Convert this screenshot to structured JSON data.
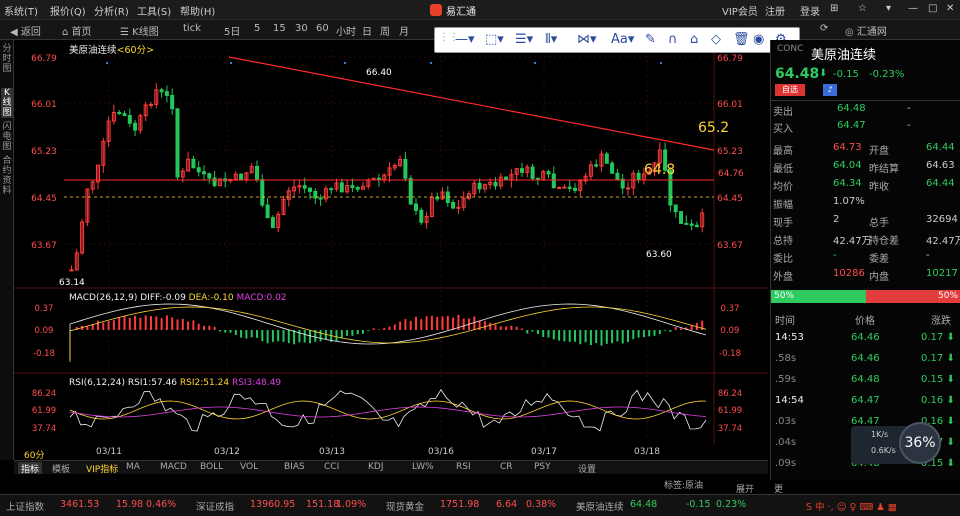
{
  "menu": {
    "items": [
      "系统(T)",
      "报价(Q)",
      "分析(R)",
      "工具(S)",
      "帮助(H)"
    ],
    "brand": "易汇通",
    "vip": "VIP会员",
    "register": "注册",
    "login": "登录"
  },
  "toolbar": {
    "back": "返回",
    "home": "首页",
    "kline": "K线图",
    "tick": "tick",
    "periods": [
      "5日",
      "5",
      "15",
      "30",
      "60",
      "小时",
      "日",
      "周",
      "月"
    ],
    "huitong": "汇通网"
  },
  "left_tabs": [
    "分时图",
    "K线图",
    "闪电图",
    "合约资料"
  ],
  "chart": {
    "title": "美原油连续",
    "period": "<60分>",
    "price_labels": [
      "66.79",
      "66.01",
      "65.23",
      "64.45",
      "63.67"
    ],
    "high_mark": "66.40",
    "low_mark": "63.14",
    "low_mark2": "63.60",
    "annot_652": "65.2",
    "annot_648": "64.8",
    "hline_value": "64.76",
    "last_value": "64.45",
    "dates": [
      "03/11",
      "03/12",
      "03/13",
      "03/16",
      "03/17",
      "03/18"
    ],
    "macd": {
      "header": "MACD(26,12,9)",
      "diff": "DIFF:-0.09",
      "dea": "DEA:-0.10",
      "macd": "MACD:0.02",
      "labels": [
        "0.37",
        "0.09",
        "-0.18"
      ]
    },
    "rsi": {
      "header": "RSI(6,12,24)",
      "rsi1": "RSI1:57.46",
      "rsi2": "RSI2:51.24",
      "rsi3": "RSI3:48.49",
      "labels": [
        "86.24",
        "61.99",
        "37.74"
      ]
    },
    "period_label": "60分"
  },
  "bottom_tabs": [
    "指标",
    "模板",
    "VIP指标",
    "MA",
    "MACD",
    "BOLL",
    "VOL",
    "BIAS",
    "CCI",
    "KDJ",
    "LW%",
    "RSI",
    "CR",
    "PSY",
    "设置"
  ],
  "bottom_tags": {
    "tag": "标签:原油",
    "expand": "展开",
    "more": "更"
  },
  "quote": {
    "code": "CONC",
    "name": "美原油连续",
    "price": "64.48",
    "change": "-0.15",
    "pct": "-0.23%",
    "self_select": "自选",
    "sell": [
      "卖出",
      "64.48",
      "-"
    ],
    "buy": [
      "买入",
      "64.47",
      "-"
    ],
    "rows": [
      [
        "最高",
        "64.73",
        "开盘",
        "64.44"
      ],
      [
        "最低",
        "64.04",
        "昨结算",
        "64.63"
      ],
      [
        "均价",
        "64.34",
        "昨收",
        "64.44"
      ],
      [
        "振幅",
        "1.07%",
        "",
        ""
      ],
      [
        "现手",
        "2",
        "总手",
        "32694"
      ],
      [
        "总持",
        "42.47万",
        "持仓差",
        "42.47万"
      ],
      [
        "委比",
        "-",
        "委差",
        "-"
      ],
      [
        "外盘",
        "10286",
        "内盘",
        "10217"
      ]
    ],
    "bar_left": "50%",
    "bar_right": "50%",
    "tick_header": [
      "时间",
      "价格",
      "涨跌"
    ],
    "ticks": [
      [
        "14:53",
        "64.46",
        "0.17"
      ],
      [
        ".58s",
        "64.46",
        "0.17"
      ],
      [
        ".59s",
        "64.48",
        "0.15"
      ],
      [
        "14:54",
        "64.47",
        "0.16"
      ],
      [
        ".03s",
        "64.47",
        "0.16"
      ],
      [
        ".04s",
        "64.46",
        "0.17"
      ],
      [
        ".09s",
        "64.48",
        "0.15"
      ]
    ],
    "speed_up": "1K/s",
    "speed_down": "0.6K/s",
    "cpu": "36%"
  },
  "status": {
    "items": [
      [
        "上证指数",
        "3461.53",
        "15.98",
        "0.46%"
      ],
      [
        "深证成指",
        "13960.95",
        "151.18",
        "1.09%"
      ],
      [
        "现货黄金",
        "1751.98",
        "6.64",
        "0.38%"
      ],
      [
        "美原油连续",
        "64.48",
        "-0.15",
        "0.23%"
      ]
    ]
  },
  "drawtools": [
    "line-tool",
    "rect-tool",
    "channel-tool",
    "text-tool",
    "fib-tool",
    "font-tool",
    "pencil-tool",
    "eraser-tool",
    "delete-tool",
    "eye-tool",
    "settings-tool"
  ]
}
